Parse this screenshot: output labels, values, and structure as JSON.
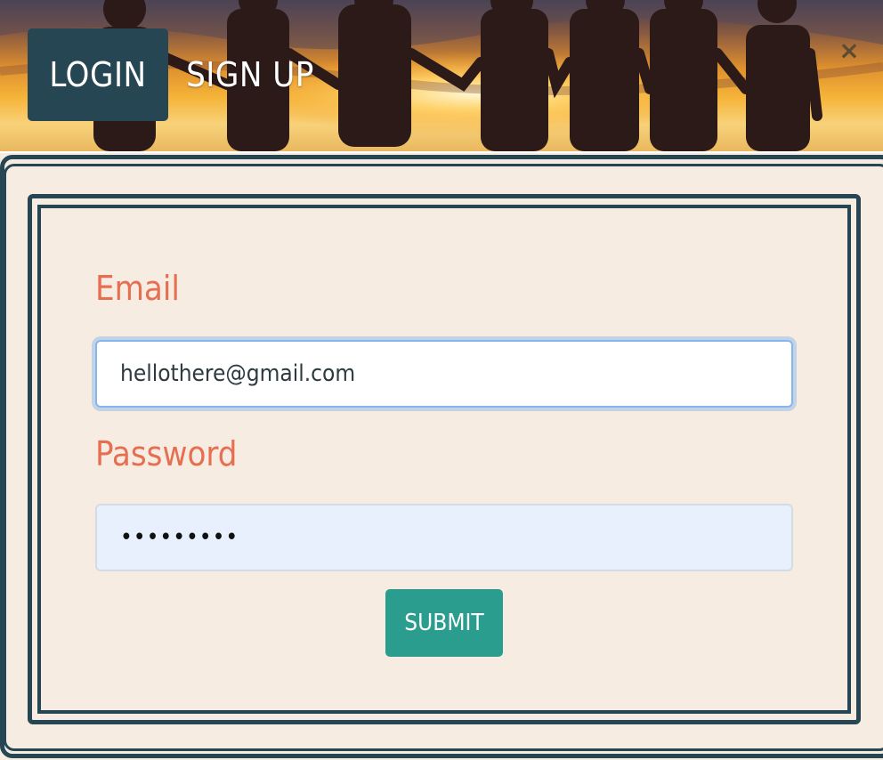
{
  "tabs": {
    "login_label": "LOGIN",
    "signup_label": "SIGN UP"
  },
  "close_label": "×",
  "form": {
    "email_label": "Email",
    "email_value": "hellothere@gmail.com",
    "password_label": "Password",
    "password_value": "•••••••••",
    "submit_label": "SUBMIT"
  },
  "colors": {
    "primary_dark": "#264653",
    "label_accent": "#e76f51",
    "submit_bg": "#2a9d8f",
    "panel_bg": "#f6ece2",
    "password_field_bg": "#e8f0fe"
  },
  "icons": {
    "close": "close-icon",
    "hero": "sunset-children-silhouette-image"
  }
}
